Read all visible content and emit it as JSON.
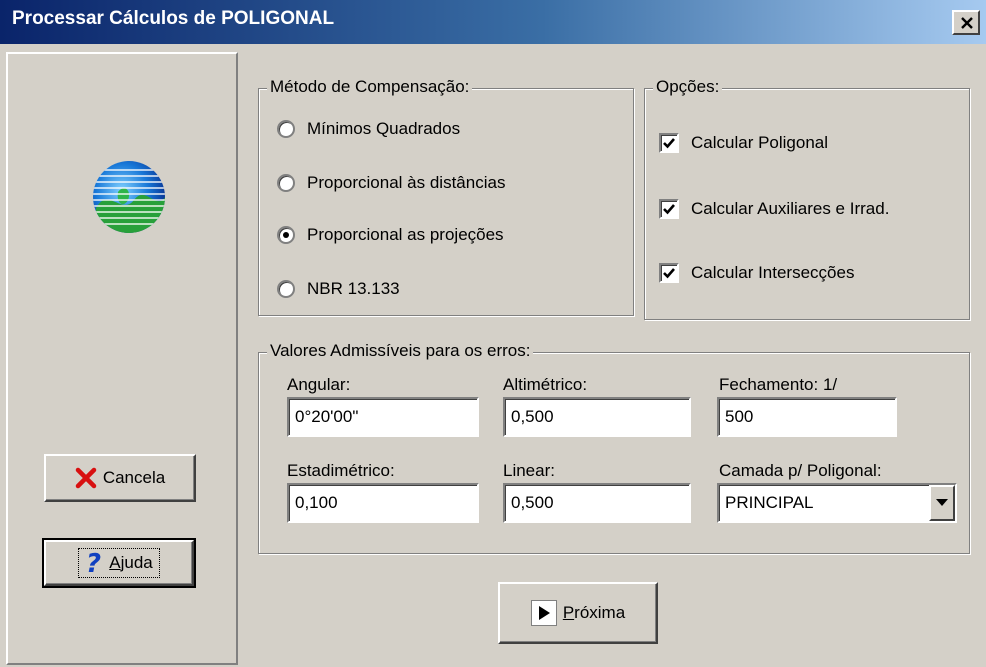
{
  "window": {
    "title": "Processar Cálculos de POLIGONAL",
    "close_label": "×"
  },
  "sidebar": {
    "logo_icon": "globe-logo-icon",
    "cancel_button": {
      "label": "Cancela",
      "icon": "red-x-icon"
    },
    "help_button": {
      "label_prefix": "",
      "label_underlined": "A",
      "label_rest": "juda",
      "icon": "question-mark-icon"
    }
  },
  "compensation": {
    "legend": "Método de Compensação:",
    "options": [
      {
        "label": "Mínimos Quadrados",
        "selected": false
      },
      {
        "label": "Proporcional às distâncias",
        "selected": false
      },
      {
        "label": "Proporcional as projeções",
        "selected": true
      },
      {
        "label": "NBR 13.133",
        "selected": false
      }
    ]
  },
  "options": {
    "legend": "Opções:",
    "items": [
      {
        "label": "Calcular Poligonal",
        "checked": true
      },
      {
        "label": "Calcular Auxiliares e Irrad.",
        "checked": true
      },
      {
        "label": "Calcular Intersecções",
        "checked": true
      }
    ]
  },
  "errors": {
    "legend": "Valores Admissíveis para os erros:",
    "angular": {
      "label": "Angular:",
      "value": " 0°20'00\""
    },
    "altimetrico": {
      "label": "Altimétrico:",
      "value": "0,500"
    },
    "fechamento": {
      "label": "Fechamento: 1/",
      "value": "500"
    },
    "estadimetrico": {
      "label": "Estadimétrico:",
      "value": "0,100"
    },
    "linear": {
      "label": "Linear:",
      "value": "0,500"
    },
    "camada": {
      "label": "Camada p/ Poligonal:",
      "value": "PRINCIPAL"
    }
  },
  "next_button": {
    "label_underlined": "P",
    "label_rest": "róxima",
    "icon": "play-arrow-icon"
  },
  "colors": {
    "face": "#d4d0c8",
    "title_start": "#0a246a",
    "title_end": "#a6caf0",
    "cancel_x": "#d81010",
    "help_q": "#1040c0"
  }
}
